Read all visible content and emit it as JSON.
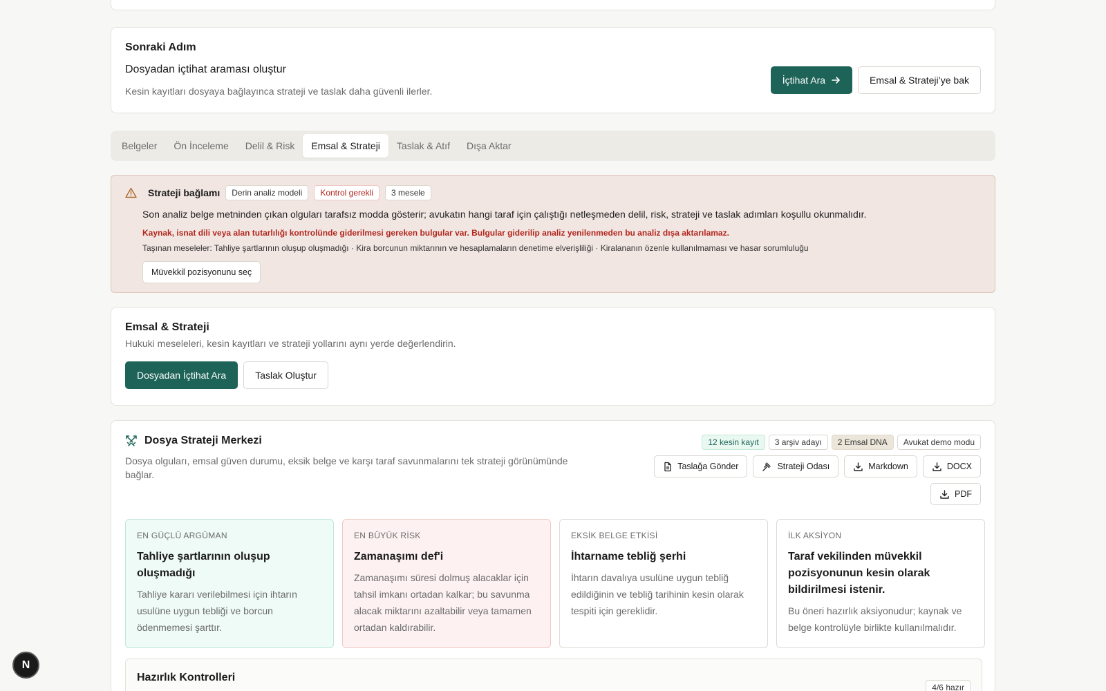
{
  "next_step": {
    "kicker": "Sonraki Adım",
    "title": "Dosyadan içtihat araması oluştur",
    "description": "Kesin kayıtları dosyaya bağlayınca strateji ve taslak daha güvenli ilerler.",
    "primary_label": "İçtihat Ara",
    "secondary_label": "Emsal & Strateji’ye bak"
  },
  "tabs": [
    {
      "label": "Belgeler"
    },
    {
      "label": "Ön İnceleme"
    },
    {
      "label": "Delil & Risk"
    },
    {
      "label": "Emsal & Strateji",
      "active": true
    },
    {
      "label": "Taslak & Atıf"
    },
    {
      "label": "Dışa Aktar"
    }
  ],
  "alert": {
    "title": "Strateji bağlamı",
    "chips": [
      "Derin analiz modeli",
      "Kontrol gerekli",
      "3 mesele"
    ],
    "text": "Son analiz belge metninden çıkan olguları tarafsız modda gösterir; avukatın hangi taraf için çalıştığı netleşmeden delil, risk, strateji ve taslak adımları koşullu okunmalıdır.",
    "warning": "Kaynak, isnat dili veya alan tutarlılığı kontrolünde giderilmesi gereken bulgular var. Bulgular giderilip analiz yenilenmeden bu analiz dışa aktarılamaz.",
    "issues": "Taşınan meseleler: Tahliye şartlarının oluşup oluşmadığı · Kira borcunun miktarının ve hesaplamaların denetime elverişliliği · Kiralananın özenle kullanılmaması ve hasar sorumluluğu",
    "button_label": "Müvekkil pozisyonunu seç"
  },
  "emsal": {
    "title": "Emsal & Strateji",
    "description": "Hukuki meseleleri, kesin kayıtları ve strateji yollarını aynı yerde değerlendirin.",
    "primary_label": "Dosyadan İçtihat Ara",
    "secondary_label": "Taslak Oluştur"
  },
  "center": {
    "title": "Dosya Strateji Merkezi",
    "description": "Dosya olguları, emsal güven durumu, eksik belge ve karşı taraf savunmalarını tek strateji görünümünde bağlar.",
    "badges": [
      "12 kesin kayıt",
      "3 arşiv adayı",
      "2 Emsal DNA",
      "Avukat demo modu"
    ],
    "exports": [
      "Taslağa Gönder",
      "Strateji Odası",
      "Markdown",
      "DOCX",
      "PDF"
    ],
    "cards": [
      {
        "kicker": "EN GÜÇLÜ ARGÜMAN",
        "title": "Tahliye şartlarının oluşup oluşmadığı",
        "desc": "Tahliye kararı verilebilmesi için ihtarın usulüne uygun tebliği ve borcun ödenmemesi şarttır."
      },
      {
        "kicker": "EN BÜYÜK RİSK",
        "title": "Zamanaşımı def'i",
        "desc": "Zamanaşımı süresi dolmuş alacaklar için tahsil imkanı ortadan kalkar; bu savunma alacak miktarını azaltabilir veya tamamen ortadan kaldırabilir."
      },
      {
        "kicker": "EKSİK BELGE ETKİSİ",
        "title": "İhtarname tebliğ şerhi",
        "desc": "İhtarın davalıya usulüne uygun tebliğ edildiğinin ve tebliğ tarihinin kesin olarak tespiti için gereklidir."
      },
      {
        "kicker": "İLK AKSİYON",
        "title": "Taraf vekilinden müvekkil pozisyonunun kesin olarak bildirilmesi istenir.",
        "desc": "Bu öneri hazırlık aksiyonudur; kaynak ve belge kontrolüyle birlikte kullanılmalıdır."
      }
    ],
    "readiness": {
      "title": "Hazırlık Kontrolleri",
      "badge": "4/6 hazır"
    }
  },
  "fab_label": "N",
  "colors": {
    "primary": "#1e6358",
    "danger": "#b3261e",
    "alert_bg": "#f1e6e2"
  }
}
